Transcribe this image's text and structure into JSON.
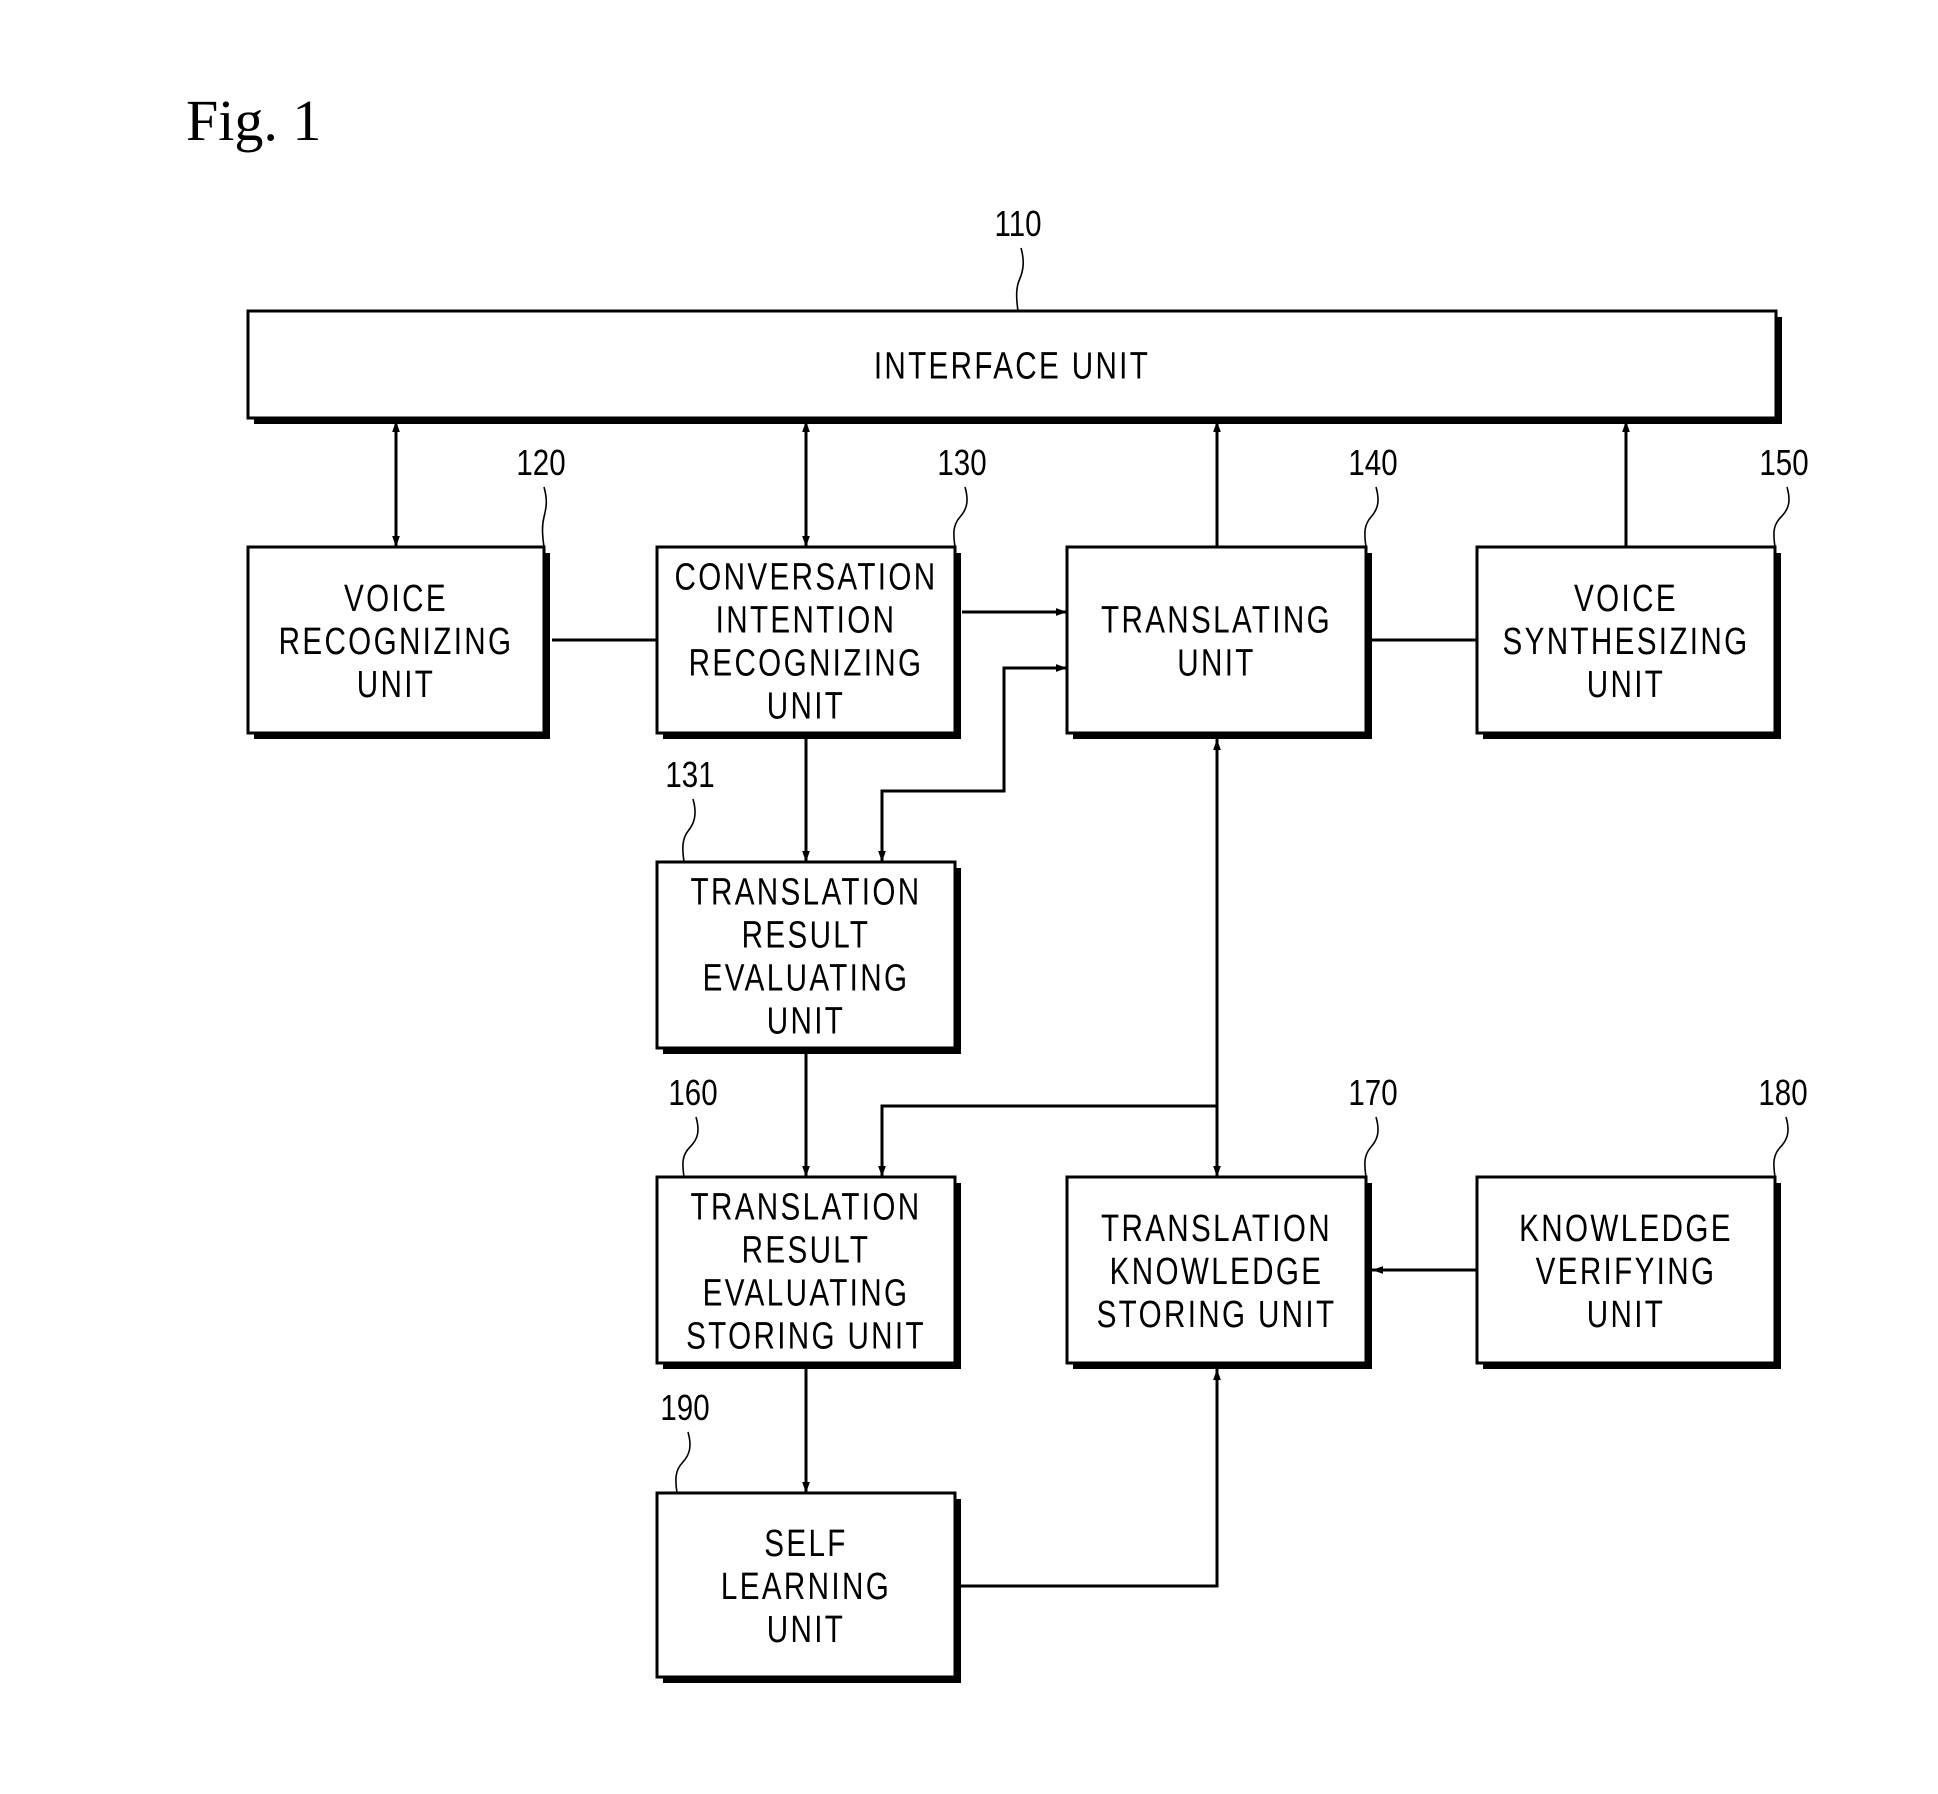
{
  "figure": {
    "title": "Fig. 1"
  },
  "colors": {
    "stroke": "#000000",
    "background": "#ffffff"
  },
  "blocks": {
    "interface": {
      "ref": "110",
      "lines": [
        "INTERFACE UNIT"
      ]
    },
    "voice_rec": {
      "ref": "120",
      "lines": [
        "VOICE",
        "RECOGNIZING",
        "UNIT"
      ]
    },
    "conv_int": {
      "ref": "130",
      "lines": [
        "CONVERSATION",
        "INTENTION",
        "RECOGNIZING",
        "UNIT"
      ]
    },
    "translating": {
      "ref": "140",
      "lines": [
        "TRANSLATING",
        "UNIT"
      ]
    },
    "voice_syn": {
      "ref": "150",
      "lines": [
        "VOICE",
        "SYNTHESIZING",
        "UNIT"
      ]
    },
    "tr_eval": {
      "ref": "131",
      "lines": [
        "TRANSLATION",
        "RESULT",
        "EVALUATING",
        "UNIT"
      ]
    },
    "tr_eval_store": {
      "ref": "160",
      "lines": [
        "TRANSLATION",
        "RESULT",
        "EVALUATING",
        "STORING UNIT"
      ]
    },
    "tr_know_store": {
      "ref": "170",
      "lines": [
        "TRANSLATION",
        "KNOWLEDGE",
        "STORING UNIT"
      ]
    },
    "know_verify": {
      "ref": "180",
      "lines": [
        "KNOWLEDGE",
        "VERIFYING",
        "UNIT"
      ]
    },
    "self_learn": {
      "ref": "190",
      "lines": [
        "SELF",
        "LEARNING",
        "UNIT"
      ]
    }
  },
  "connections": [
    {
      "from": "interface",
      "to": "voice_rec",
      "direction": "bidirectional"
    },
    {
      "from": "interface",
      "to": "conv_int",
      "direction": "bidirectional"
    },
    {
      "from": "translating",
      "to": "interface",
      "direction": "forward"
    },
    {
      "from": "voice_syn",
      "to": "interface",
      "direction": "forward"
    },
    {
      "from": "voice_rec",
      "to": "conv_int",
      "direction": "none"
    },
    {
      "from": "conv_int",
      "to": "translating",
      "direction": "forward"
    },
    {
      "from": "translating",
      "to": "voice_syn",
      "direction": "none"
    },
    {
      "from": "conv_int",
      "to": "tr_eval",
      "direction": "forward"
    },
    {
      "from": "tr_eval",
      "to": "translating",
      "direction": "bidirectional"
    },
    {
      "from": "tr_eval",
      "to": "tr_eval_store",
      "direction": "forward"
    },
    {
      "from": "translating",
      "to": "tr_know_store",
      "direction": "bidirectional"
    },
    {
      "from": "tr_know_store",
      "to": "tr_eval_store",
      "direction": "forward"
    },
    {
      "from": "know_verify",
      "to": "tr_know_store",
      "direction": "forward"
    },
    {
      "from": "tr_eval_store",
      "to": "self_learn",
      "direction": "forward"
    },
    {
      "from": "self_learn",
      "to": "tr_know_store",
      "direction": "forward"
    }
  ]
}
